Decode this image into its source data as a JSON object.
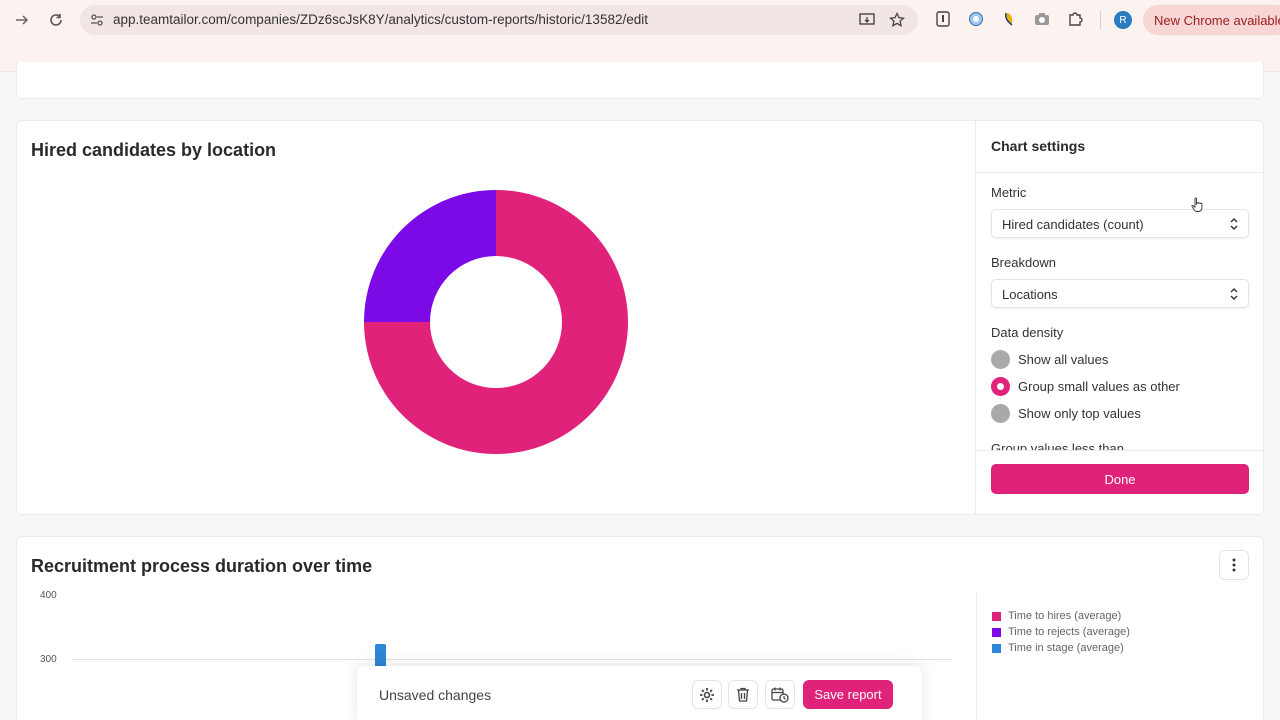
{
  "browser": {
    "url": "app.teamtailor.com/companies/ZDz6scJsK8Y/analytics/custom-reports/historic/13582/edit",
    "profile_initial": "R",
    "update_label": "New Chrome available"
  },
  "pie_card": {
    "title": "Hired candidates by location"
  },
  "chart_data": [
    {
      "type": "pie",
      "title": "Hired candidates by location",
      "donut": true,
      "slices": [
        {
          "value": 75,
          "color": "#e0227a"
        },
        {
          "value": 25,
          "color": "#7b0ae6"
        }
      ]
    },
    {
      "type": "bar",
      "title": "Recruitment process duration over time",
      "y_ticks": [
        "400",
        "300"
      ],
      "ylim": [
        300,
        400
      ],
      "legend_position": "right",
      "series": [
        {
          "name": "Time to hires (average)",
          "color": "#e0227a"
        },
        {
          "name": "Time to rejects (average)",
          "color": "#7b0ae6"
        },
        {
          "name": "Time in stage (average)",
          "color": "#2e86d6"
        }
      ]
    }
  ],
  "settings": {
    "title": "Chart settings",
    "metric_label": "Metric",
    "metric_value": "Hired candidates (count)",
    "breakdown_label": "Breakdown",
    "breakdown_value": "Locations",
    "density_label": "Data density",
    "options": [
      {
        "label": "Show all values",
        "selected": false
      },
      {
        "label": "Group small values as other",
        "selected": true
      },
      {
        "label": "Show only top values",
        "selected": false
      }
    ],
    "clipped_label": "Group values less than",
    "done_label": "Done"
  },
  "duration_card": {
    "title": "Recruitment process duration over time"
  },
  "unsaved": {
    "text": "Unsaved changes",
    "save_label": "Save report"
  },
  "colors": {
    "accent": "#e0227a",
    "purple": "#7b0ae6",
    "blue": "#2e86d6"
  }
}
